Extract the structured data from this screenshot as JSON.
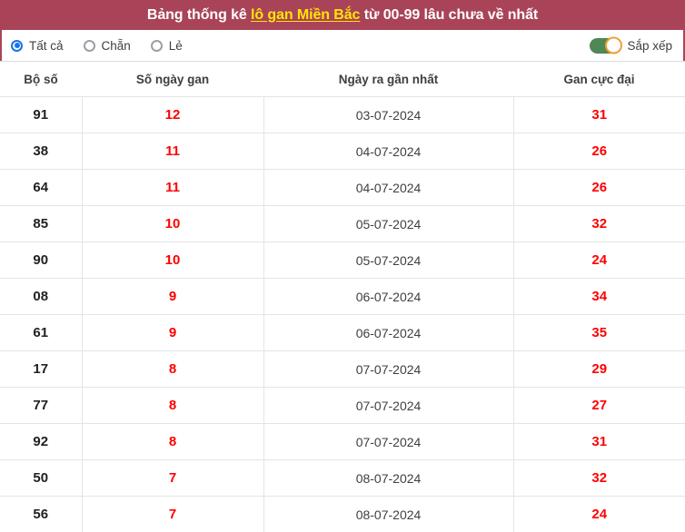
{
  "header": {
    "title_prefix": "Bảng thống kê ",
    "title_highlight": "lô gan Miền Bắc",
    "title_suffix": " từ 00-99 lâu chưa về nhất",
    "bg_color": "#a94458",
    "highlight_color": "#ffe500"
  },
  "controls": {
    "radios": [
      {
        "label": "Tất cả",
        "checked": true
      },
      {
        "label": "Chẵn",
        "checked": false
      },
      {
        "label": "Lẻ",
        "checked": false
      }
    ],
    "radio_accent": "#1a73e8",
    "sort": {
      "label": "Sắp xếp",
      "enabled": true,
      "track_color": "#4f8757",
      "knob_ring_color": "#f0a132"
    }
  },
  "table": {
    "columns": [
      "Bộ số",
      "Số ngày gan",
      "Ngày ra gần nhất",
      "Gan cực đại"
    ],
    "value_color": "#ff0000",
    "rows": [
      {
        "bo_so": "91",
        "so_ngay_gan": "12",
        "ngay_ra_gan_nhat": "03-07-2024",
        "gan_cuc_dai": "31"
      },
      {
        "bo_so": "38",
        "so_ngay_gan": "11",
        "ngay_ra_gan_nhat": "04-07-2024",
        "gan_cuc_dai": "26"
      },
      {
        "bo_so": "64",
        "so_ngay_gan": "11",
        "ngay_ra_gan_nhat": "04-07-2024",
        "gan_cuc_dai": "26"
      },
      {
        "bo_so": "85",
        "so_ngay_gan": "10",
        "ngay_ra_gan_nhat": "05-07-2024",
        "gan_cuc_dai": "32"
      },
      {
        "bo_so": "90",
        "so_ngay_gan": "10",
        "ngay_ra_gan_nhat": "05-07-2024",
        "gan_cuc_dai": "24"
      },
      {
        "bo_so": "08",
        "so_ngay_gan": "9",
        "ngay_ra_gan_nhat": "06-07-2024",
        "gan_cuc_dai": "34"
      },
      {
        "bo_so": "61",
        "so_ngay_gan": "9",
        "ngay_ra_gan_nhat": "06-07-2024",
        "gan_cuc_dai": "35"
      },
      {
        "bo_so": "17",
        "so_ngay_gan": "8",
        "ngay_ra_gan_nhat": "07-07-2024",
        "gan_cuc_dai": "29"
      },
      {
        "bo_so": "77",
        "so_ngay_gan": "8",
        "ngay_ra_gan_nhat": "07-07-2024",
        "gan_cuc_dai": "27"
      },
      {
        "bo_so": "92",
        "so_ngay_gan": "8",
        "ngay_ra_gan_nhat": "07-07-2024",
        "gan_cuc_dai": "31"
      },
      {
        "bo_so": "50",
        "so_ngay_gan": "7",
        "ngay_ra_gan_nhat": "08-07-2024",
        "gan_cuc_dai": "32"
      },
      {
        "bo_so": "56",
        "so_ngay_gan": "7",
        "ngay_ra_gan_nhat": "08-07-2024",
        "gan_cuc_dai": "24"
      }
    ]
  }
}
